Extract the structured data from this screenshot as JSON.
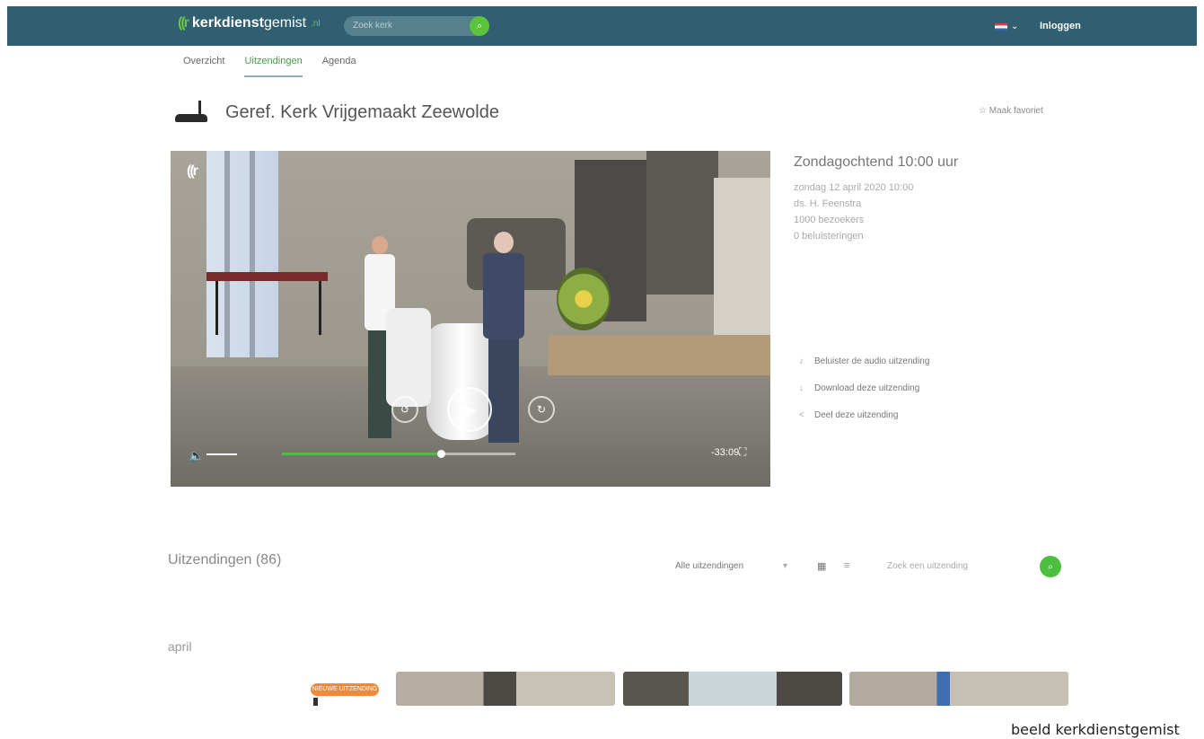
{
  "header": {
    "logo_mark": "((r",
    "logo_bold": "kerkdienst",
    "logo_rest": "gemist",
    "logo_suffix": ".nl",
    "search_placeholder": "Zoek kerk",
    "language": "NL",
    "login_label": "Inloggen"
  },
  "tabs": [
    {
      "label": "Overzicht"
    },
    {
      "label": "Uitzendingen"
    },
    {
      "label": "Agenda"
    }
  ],
  "church": {
    "name": "Geref. Kerk Vrijgemaakt Zeewolde",
    "favorite_label": "Maak favoriet"
  },
  "player": {
    "watermark": "((r",
    "time_remaining": "-33:09",
    "progress": 0.68,
    "play_icon": "play-icon",
    "rewind_icon": "rewind-icon",
    "forward_icon": "forward-icon",
    "volume_icon": "volume-icon",
    "fullscreen_icon": "fullscreen-icon"
  },
  "broadcast": {
    "title": "Zondagochtend 10:00 uur",
    "date": "zondag 12 april 2020 10:00",
    "meta": [
      "ds. H. Feenstra",
      "1000 bezoekers",
      "0 beluisteringen"
    ]
  },
  "actions": [
    {
      "icon": "audio-icon",
      "label": "Beluister de audio uitzending"
    },
    {
      "icon": "download-icon",
      "label": "Download deze uitzending"
    },
    {
      "icon": "share-icon",
      "label": "Deel deze uitzending"
    }
  ],
  "listing": {
    "title": "Uitzendingen (86)",
    "filter_label": "Alle uitzendingen",
    "filter_chevron": "▾",
    "grid_icon": "▦",
    "list_icon": "≡",
    "search_placeholder": "Zoek een uitzending",
    "month": "april",
    "badge_label": "NIEUWE UITZENDING"
  },
  "caption": "beeld kerkdienstgemist",
  "colors": {
    "topbar": "#2f5f70",
    "accent_green": "#4cbf3e",
    "badge_orange": "#f08a3a"
  }
}
